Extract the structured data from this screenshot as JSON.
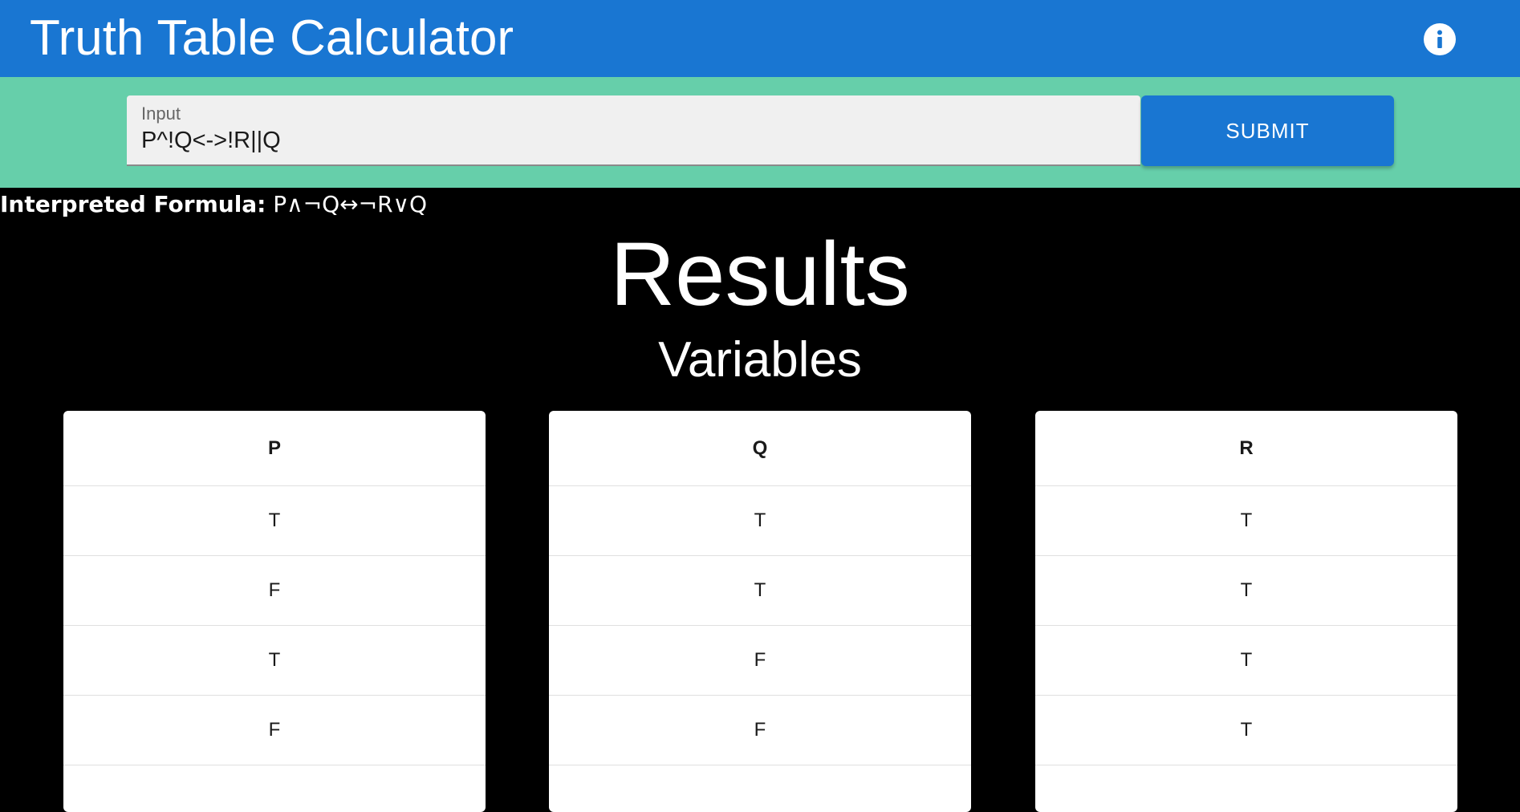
{
  "app": {
    "title": "Truth Table Calculator",
    "accent_color": "#1976d2",
    "input_bar_color": "#66cfaa",
    "info_icon": "info-icon"
  },
  "input": {
    "label": "Input",
    "value": "P^!Q<->!R||Q",
    "submit_label": "SUBMIT"
  },
  "formula": {
    "label": "Interpreted Formula:",
    "value": "P∧¬Q↔¬R∨Q"
  },
  "results": {
    "heading": "Results",
    "subheading": "Variables",
    "tables": [
      {
        "header": "P",
        "values": [
          "T",
          "F",
          "T",
          "F"
        ]
      },
      {
        "header": "Q",
        "values": [
          "T",
          "T",
          "F",
          "F"
        ]
      },
      {
        "header": "R",
        "values": [
          "T",
          "T",
          "T",
          "T"
        ]
      }
    ]
  }
}
